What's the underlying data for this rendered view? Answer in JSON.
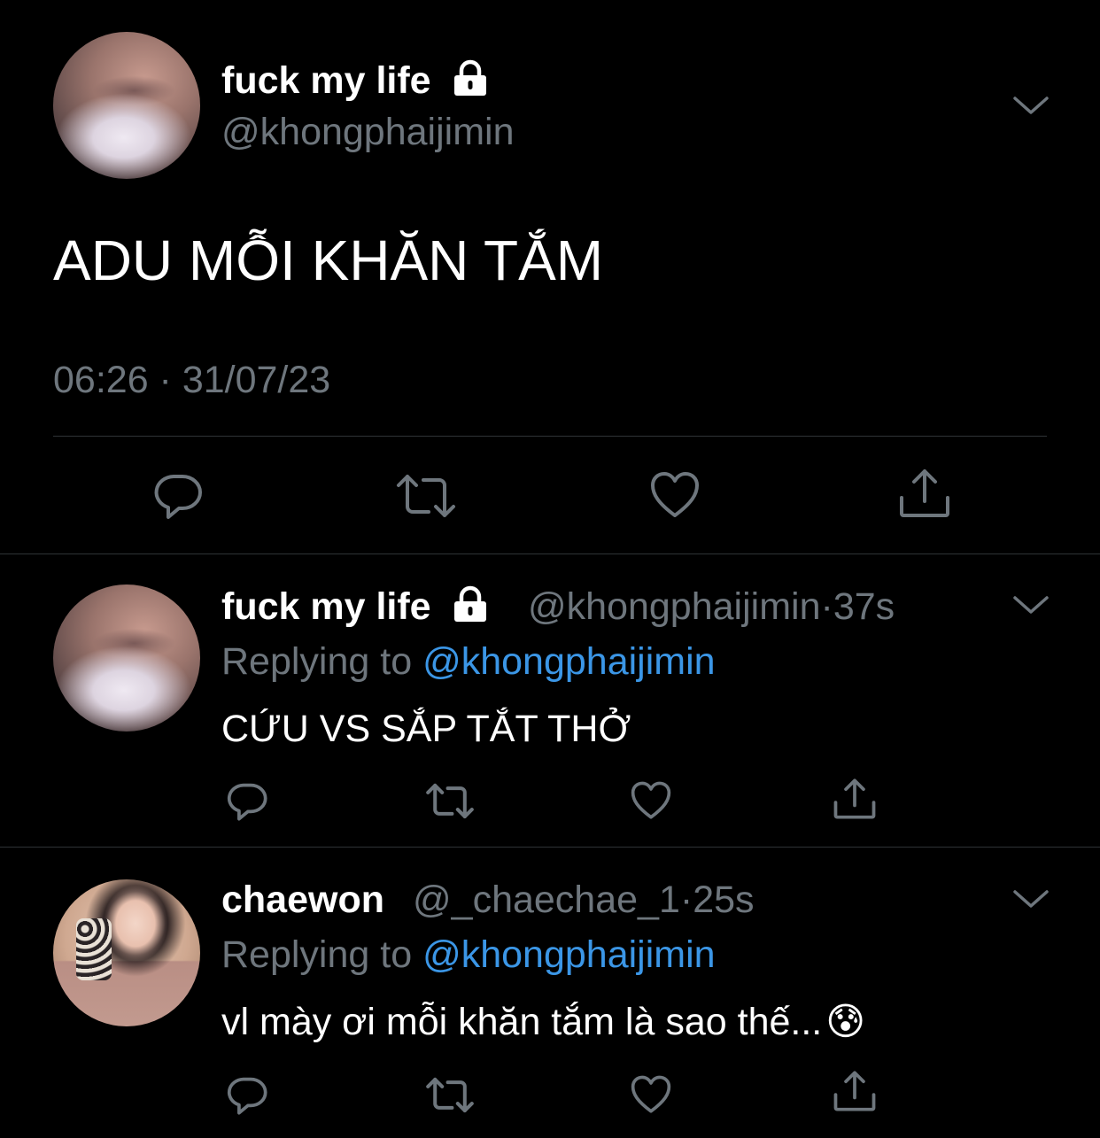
{
  "colors": {
    "background": "#000000",
    "divider": "#2f3336",
    "secondary_text": "#6e767d",
    "mention": "#3b96e6",
    "icon": "#6e767d"
  },
  "main_tweet": {
    "name": "fuck my life",
    "handle": "@khongphaijimin",
    "protected_icon": "lock-icon",
    "text": "ADU MỖI KHĂN TẮM",
    "timestamp": "06:26 · 31/07/23"
  },
  "actions": {
    "reply_icon": "reply-icon",
    "retweet_icon": "retweet-icon",
    "like_icon": "heart-icon",
    "share_icon": "share-icon",
    "more_icon": "chevron-down-icon"
  },
  "replies": [
    {
      "name": "fuck my life",
      "protected_icon": "lock-icon",
      "handle": "@khongphaijimin",
      "separator": "·",
      "time": "37s",
      "replying_prefix": "Replying to ",
      "replying_to": "@khongphaijimin",
      "text": "CỨU VS SẮP TẮT THỞ"
    },
    {
      "name": "chaewon",
      "handle": "@_chaechae_1",
      "separator": "·",
      "time": "25s",
      "replying_prefix": "Replying to ",
      "replying_to": "@khongphaijimin",
      "text": "vl mày ơi mỗi khăn tắm là sao thế...",
      "emoji": "😰"
    }
  ]
}
